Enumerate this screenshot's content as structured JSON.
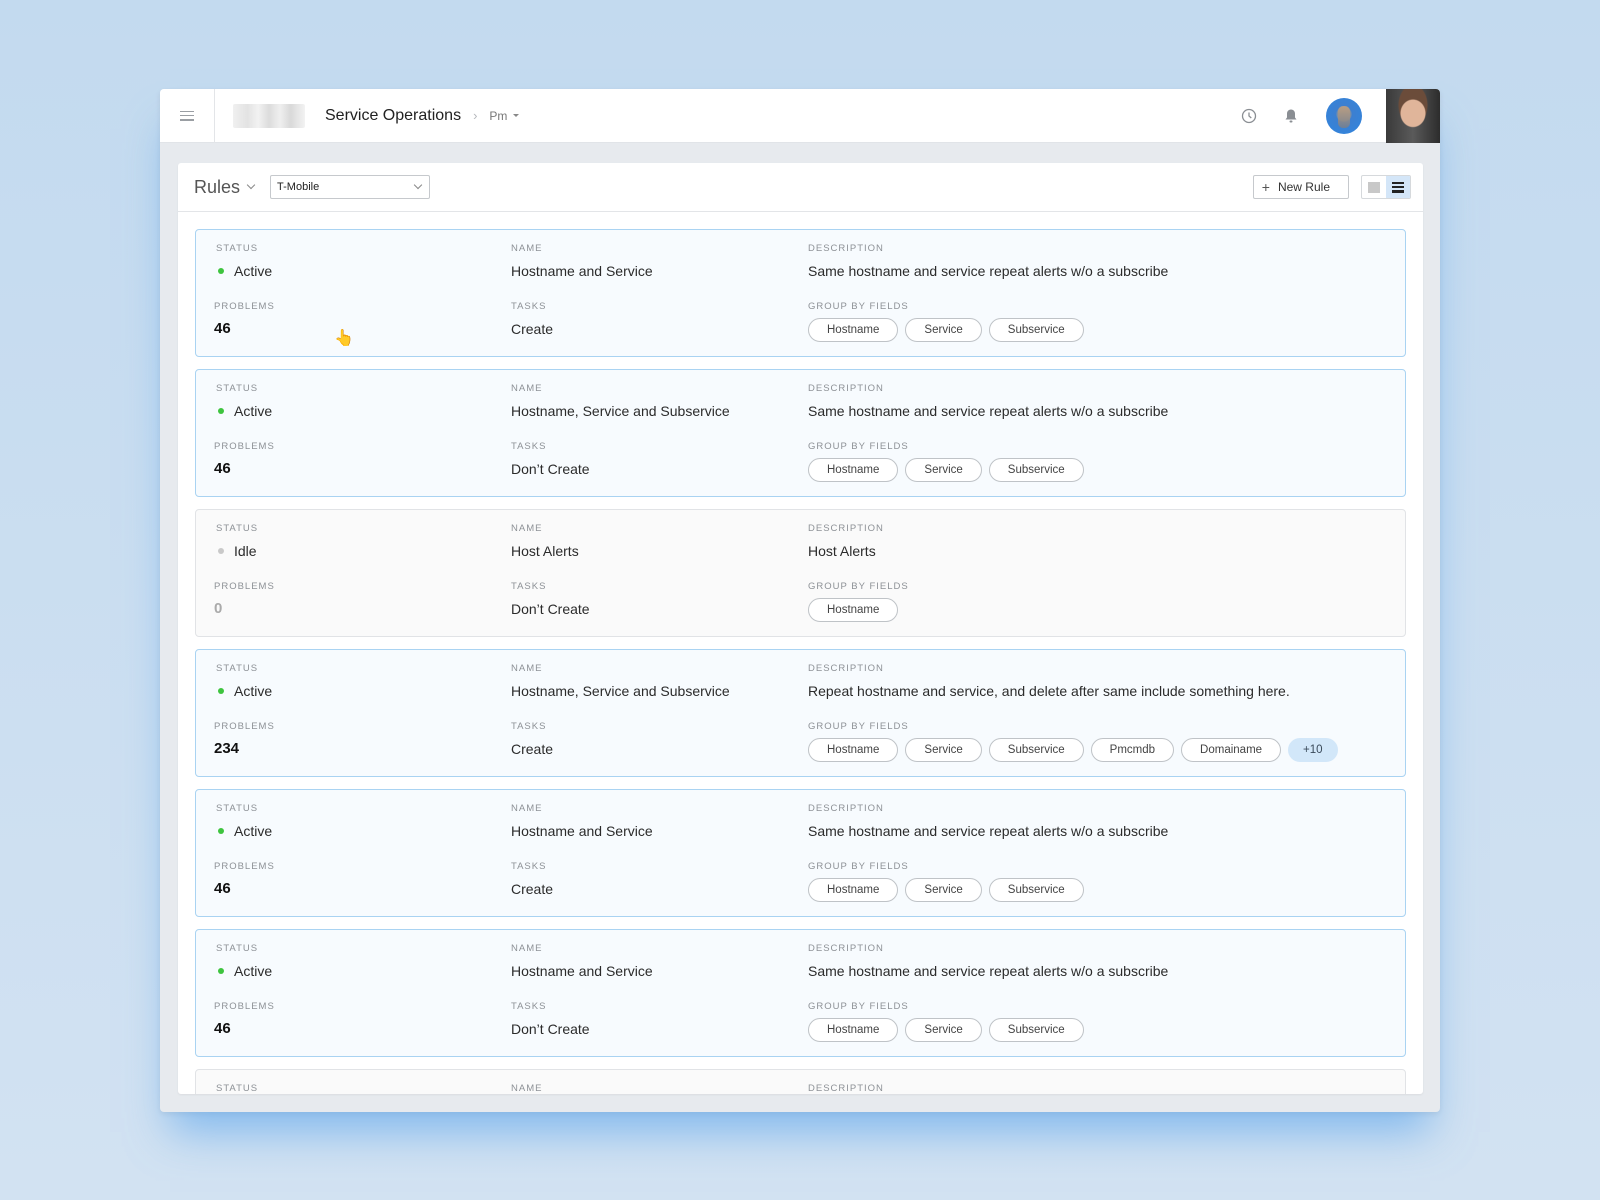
{
  "topbar": {
    "app_title": "Service Operations",
    "breadcrumb": "Pm",
    "icons": {
      "menu": "hamburger-icon",
      "history": "clock-icon",
      "notifications": "bell-icon"
    }
  },
  "panel": {
    "title": "Rules",
    "account_select": {
      "value": "T-Mobile"
    },
    "new_rule_label": "New Rule",
    "view_modes": [
      "grid",
      "list"
    ],
    "active_view": "list"
  },
  "labels": {
    "status": "Status",
    "name": "Name",
    "description": "Description",
    "problems": "Problems",
    "tasks": "Tasks",
    "group_by": "Group by fields"
  },
  "colors": {
    "active": "#3ec43e",
    "idle": "#c9c9c9",
    "accent_border": "#a9d3f2"
  },
  "rules": [
    {
      "status": "Active",
      "name": "Hostname and Service",
      "description": "Same hostname and service repeat alerts w/o a subscribe",
      "problems": "46",
      "tasks": "Create",
      "fields": [
        "Hostname",
        "Service",
        "Subservice"
      ],
      "more": ""
    },
    {
      "status": "Active",
      "name": "Hostname, Service and Subservice",
      "description": "Same hostname and service repeat alerts w/o a subscribe",
      "problems": "46",
      "tasks": "Don’t Create",
      "fields": [
        "Hostname",
        "Service",
        "Subservice"
      ],
      "more": ""
    },
    {
      "status": "Idle",
      "name": "Host Alerts",
      "description": "Host Alerts",
      "problems": "0",
      "tasks": "Don’t Create",
      "fields": [
        "Hostname"
      ],
      "more": ""
    },
    {
      "status": "Active",
      "name": "Hostname, Service and Subservice",
      "description": "Repeat hostname and service, and delete after same include something here.",
      "problems": "234",
      "tasks": "Create",
      "fields": [
        "Hostname",
        "Service",
        "Subservice",
        "Pmcmdb",
        "Domainame"
      ],
      "more": "+10"
    },
    {
      "status": "Active",
      "name": "Hostname and Service",
      "description": "Same hostname and service repeat alerts w/o a subscribe",
      "problems": "46",
      "tasks": "Create",
      "fields": [
        "Hostname",
        "Service",
        "Subservice"
      ],
      "more": ""
    },
    {
      "status": "Active",
      "name": "Hostname and Service",
      "description": "Same hostname and service repeat alerts w/o a subscribe",
      "problems": "46",
      "tasks": "Don’t Create",
      "fields": [
        "Hostname",
        "Service",
        "Subservice"
      ],
      "more": ""
    }
  ]
}
